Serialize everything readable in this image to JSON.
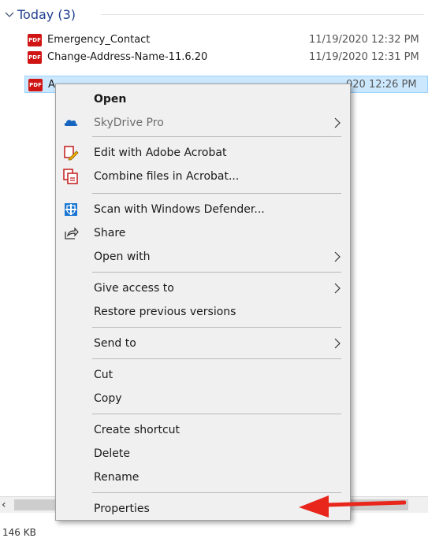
{
  "group": {
    "title": "Today (3)"
  },
  "files": [
    {
      "name": "Emergency_Contact",
      "date": "11/19/2020 12:32 PM",
      "icon": "pdf-icon",
      "icon_text": "PDF"
    },
    {
      "name": "Change-Address-Name-11.6.20",
      "date": "11/19/2020 12:31 PM",
      "icon": "pdf-icon",
      "icon_text": "PDF"
    },
    {
      "name": "A",
      "date": "020 12:26 PM",
      "icon": "pdf-icon",
      "icon_text": "PDF",
      "selected": true
    }
  ],
  "context_menu": {
    "open": "Open",
    "skydrive_pro": "SkyDrive Pro",
    "edit_acrobat": "Edit with Adobe Acrobat",
    "combine_acrobat": "Combine files in Acrobat...",
    "scan_defender": "Scan with Windows Defender...",
    "share": "Share",
    "open_with": "Open with",
    "give_access": "Give access to",
    "restore_versions": "Restore previous versions",
    "send_to": "Send to",
    "cut": "Cut",
    "copy": "Copy",
    "create_shortcut": "Create shortcut",
    "delete": "Delete",
    "rename": "Rename",
    "properties": "Properties"
  },
  "status": {
    "size": "146 KB"
  },
  "colors": {
    "selection": "#cce8ff",
    "pdf_red": "#d01414",
    "menu_bg": "#f0f0f0",
    "annotation_arrow": "#e8261b",
    "group_title": "#1e3f8f"
  }
}
